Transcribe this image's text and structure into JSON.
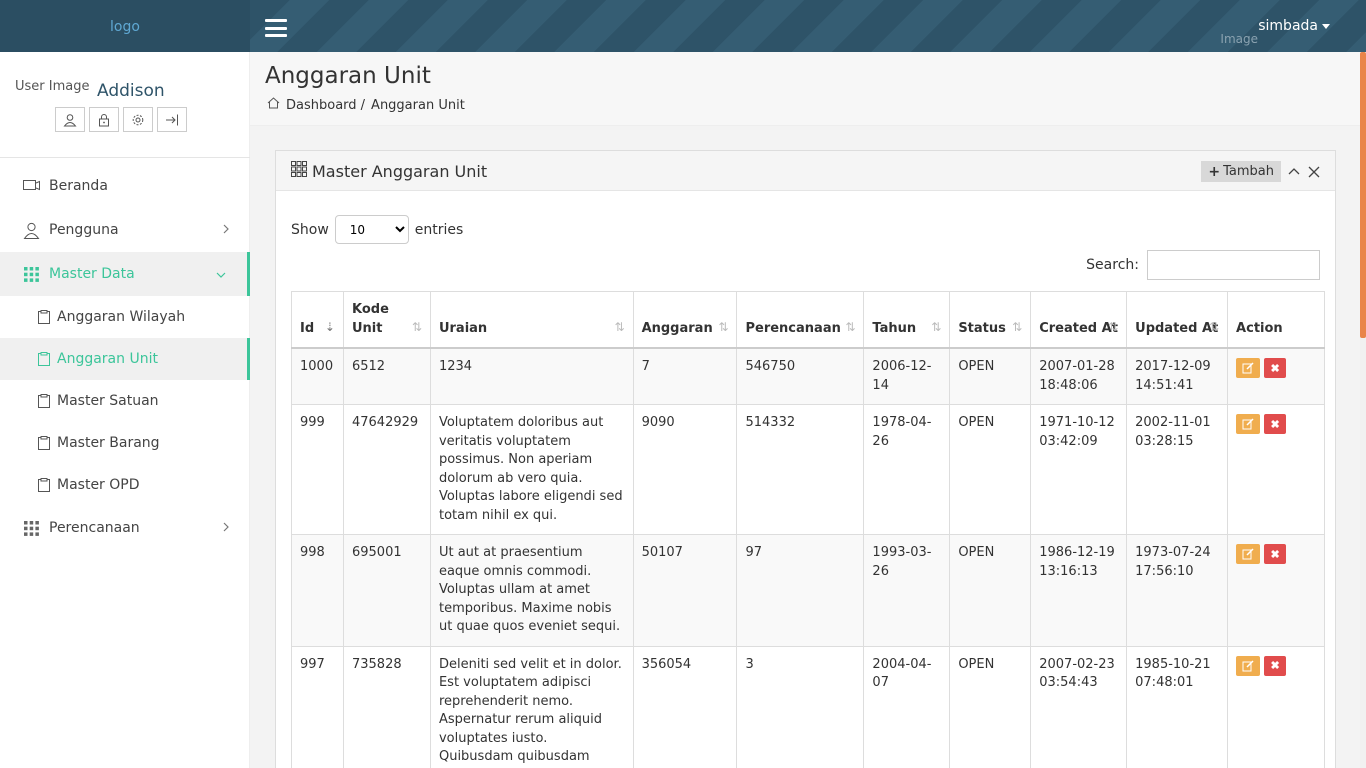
{
  "topbar": {
    "logo": "logo",
    "user_menu": "simbada",
    "user_image_alt": "Image"
  },
  "user_panel": {
    "image_alt": "User Image",
    "name": "Addison"
  },
  "sidebar": {
    "items": [
      {
        "label": "Beranda"
      },
      {
        "label": "Pengguna"
      },
      {
        "label": "Master Data"
      },
      {
        "label": "Perencanaan"
      }
    ],
    "sub_items": [
      {
        "label": "Anggaran Wilayah"
      },
      {
        "label": "Anggaran Unit"
      },
      {
        "label": "Master Satuan"
      },
      {
        "label": "Master Barang"
      },
      {
        "label": "Master OPD"
      }
    ]
  },
  "header": {
    "title": "Anggaran Unit",
    "breadcrumb_home": "Dashboard /",
    "breadcrumb_current": "Anggaran Unit"
  },
  "box": {
    "title": "Master Anggaran Unit",
    "add_label": "Tambah",
    "show_label": "Show",
    "entries_label": "entries",
    "entries_value": "10",
    "search_label": "Search:",
    "search_value": ""
  },
  "table": {
    "columns": [
      "Id",
      "Kode Unit",
      "Uraian",
      "Anggaran",
      "Perencanaan",
      "Tahun",
      "Status",
      "Created At",
      "Updated At",
      "Action"
    ],
    "rows": [
      {
        "id": "1000",
        "kode": "6512",
        "uraian": "1234",
        "anggaran": "7",
        "perencanaan": "546750",
        "tahun": "2006-12-14",
        "status": "OPEN",
        "created": "2007-01-28 18:48:06",
        "updated": "2017-12-09 14:51:41"
      },
      {
        "id": "999",
        "kode": "47642929",
        "uraian": "Voluptatem doloribus aut veritatis voluptatem possimus. Non aperiam dolorum ab vero quia. Voluptas labore eligendi sed totam nihil ex qui.",
        "anggaran": "9090",
        "perencanaan": "514332",
        "tahun": "1978-04-26",
        "status": "OPEN",
        "created": "1971-10-12 03:42:09",
        "updated": "2002-11-01 03:28:15"
      },
      {
        "id": "998",
        "kode": "695001",
        "uraian": "Ut aut at praesentium eaque omnis commodi. Voluptas ullam at amet temporibus. Maxime nobis ut quae quos eveniet sequi.",
        "anggaran": "50107",
        "perencanaan": "97",
        "tahun": "1993-03-26",
        "status": "OPEN",
        "created": "1986-12-19 13:16:13",
        "updated": "1973-07-24 17:56:10"
      },
      {
        "id": "997",
        "kode": "735828",
        "uraian": "Deleniti sed velit et in dolor. Est voluptatem adipisci reprehenderit nemo. Aspernatur rerum aliquid voluptates iusto. Quibusdam quibusdam voluptates vel ipsum officiis",
        "anggaran": "356054",
        "perencanaan": "3",
        "tahun": "2004-04-07",
        "status": "OPEN",
        "created": "2007-02-23 03:54:43",
        "updated": "1985-10-21 07:48:01"
      }
    ]
  },
  "colors": {
    "topbar": "#2f5469",
    "accent": "#3cc59a",
    "edit": "#f0ad4e",
    "delete": "#e14c4c"
  }
}
